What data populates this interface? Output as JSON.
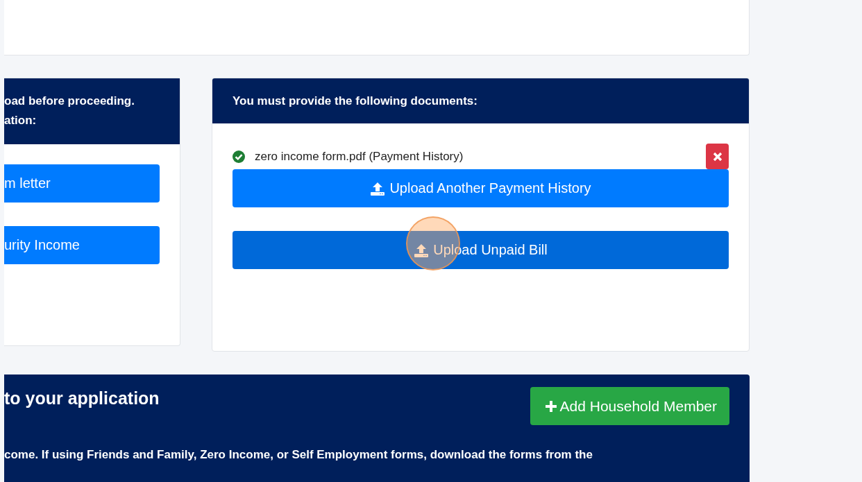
{
  "required_panel": {
    "header_lines": [
      "oad before proceeding.",
      "ation:"
    ],
    "buttons": [
      {
        "label": "m letter"
      },
      {
        "label": "urity Income"
      }
    ]
  },
  "documents_panel": {
    "header": "You must provide the following documents:",
    "uploaded": [
      {
        "file": "zero income form.pdf (Payment History)",
        "verified": true
      }
    ],
    "buttons": [
      {
        "label": "Upload Another Payment History",
        "hovered": false
      },
      {
        "label": "Upload Unpaid Bill",
        "hovered": true
      }
    ]
  },
  "household_panel": {
    "title": "to your application",
    "add_button": "Add Household Member",
    "text": "come. If using Friends and Family, Zero Income, or Self Employment forms, download the forms from the"
  }
}
